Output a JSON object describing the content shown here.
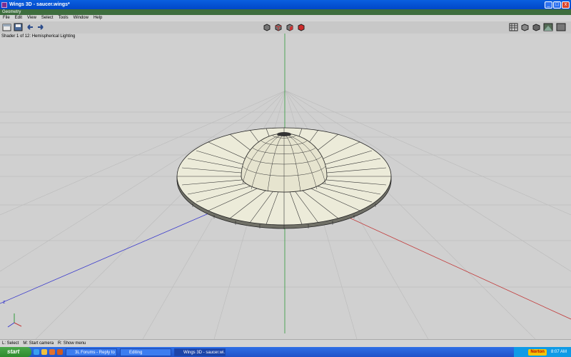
{
  "window": {
    "title": "Wings 3D - saucer.wings*",
    "min": "_",
    "max": "□",
    "close": "x"
  },
  "geometry_bar": {
    "label": "Geometry"
  },
  "menu": [
    "File",
    "Edit",
    "View",
    "Select",
    "Tools",
    "Window",
    "Help"
  ],
  "toolbar": {
    "left_icons": [
      "new-file-icon",
      "save-icon",
      "undo-icon",
      "redo-icon"
    ],
    "center_icons": [
      "vertex-mode-icon",
      "edge-mode-icon",
      "face-mode-icon",
      "body-mode-icon"
    ],
    "right_icons": [
      "grid-toggle-icon",
      "wireframe-icon",
      "smooth-icon",
      "perspective-icon",
      "ortho-icon"
    ],
    "accent": "#cc2a2a"
  },
  "viewport": {
    "shader_info": "Shader 1 of 12: Hemispherical Lighting",
    "axis_label": "z"
  },
  "status": {
    "items": [
      "L: Select",
      "M: Start camera",
      "R: Show menu"
    ]
  },
  "taskbar": {
    "start": "start",
    "tasks": [
      "3L Forums - Reply to ...",
      "Editing",
      "Wings 3D - saucer.wi..."
    ],
    "norton": "Norton",
    "clock": "8:07 AM"
  }
}
